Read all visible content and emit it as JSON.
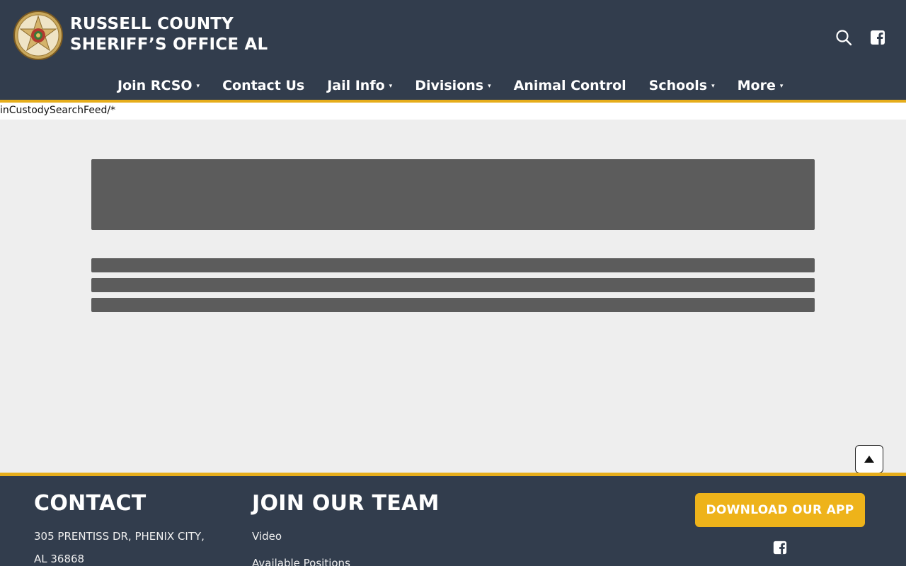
{
  "header": {
    "title_line1": "RUSSELL COUNTY",
    "title_line2": "SHERIFF’S OFFICE AL"
  },
  "nav": {
    "items": [
      {
        "label": "Join RCSO",
        "dropdown": true
      },
      {
        "label": "Contact Us",
        "dropdown": false
      },
      {
        "label": "Jail Info",
        "dropdown": true
      },
      {
        "label": "Divisions",
        "dropdown": true
      },
      {
        "label": "Animal Control",
        "dropdown": false
      },
      {
        "label": "Schools",
        "dropdown": true
      },
      {
        "label": "More",
        "dropdown": true
      }
    ],
    "caret": "▾"
  },
  "feed": {
    "text": "inCustodySearchFeed/*"
  },
  "footer": {
    "contact_heading": "CONTACT",
    "address_line1": "305 PRENTISS DR, PHENIX CITY,",
    "address_line2": "AL 36868",
    "join_heading": "JOIN OUR TEAM",
    "join_links": [
      "Video",
      "Available Positions"
    ],
    "app_button": "DOWNLOAD OUR APP"
  },
  "colors": {
    "header_bg": "#323d4d",
    "accent": "#e6ad1b",
    "placeholder": "#5c5c5c",
    "page_bg": "#eeeeee"
  },
  "icons": [
    "badge-logo",
    "search-icon",
    "facebook-icon",
    "caret-down-icon",
    "arrow-up-icon"
  ]
}
